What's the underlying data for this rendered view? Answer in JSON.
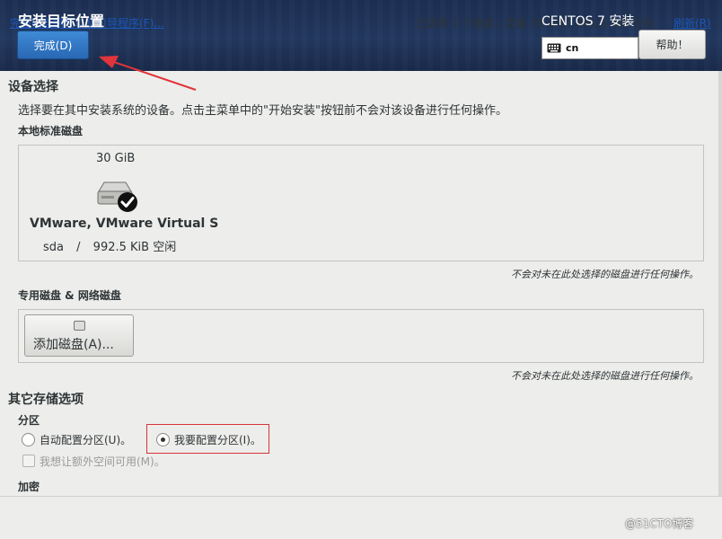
{
  "header": {
    "title": "安装目标位置",
    "done_label": "完成(D)",
    "product": "CENTOS 7 安装",
    "keyboard_layout": "cn",
    "help_label": "帮助！"
  },
  "device_selection": {
    "heading": "设备选择",
    "description": "选择要在其中安装系统的设备。点击主菜单中的\"开始安装\"按钮前不会对该设备进行任何操作。",
    "local_disks": {
      "heading": "本地标准磁盘",
      "disks": [
        {
          "size": "30 GiB",
          "name": "VMware, VMware Virtual S",
          "device": "sda",
          "separator": "/",
          "free": "992.5 KiB 空闲",
          "selected": true
        }
      ],
      "note": "不会对未在此处选择的磁盘进行任何操作。"
    },
    "specialized_disks": {
      "heading": "专用磁盘 & 网络磁盘",
      "add_label": "添加磁盘(A)...",
      "note": "不会对未在此处选择的磁盘进行任何操作。"
    }
  },
  "other_storage": {
    "heading": "其它存储选项",
    "partitioning": {
      "heading": "分区",
      "auto_label": "自动配置分区(U)。",
      "manual_label": "我要配置分区(I)。",
      "selected": "manual",
      "extra_space_label": "我想让额外空间可用(M)。"
    },
    "encryption": {
      "heading": "加密"
    }
  },
  "footer": {
    "summary_link": "完整磁盘摘要以及引导程序(F)...",
    "status": "已选择 1 个磁盘；容量 30 GiB；992.5 KiB 空闲",
    "refresh_label": "刷新(R)",
    "watermark": "@51CTO博客"
  },
  "colors": {
    "header_bg": "#23385f",
    "done_button": "#3a7fcb",
    "link": "#1b56b8",
    "annotation_red": "#d9343a"
  }
}
